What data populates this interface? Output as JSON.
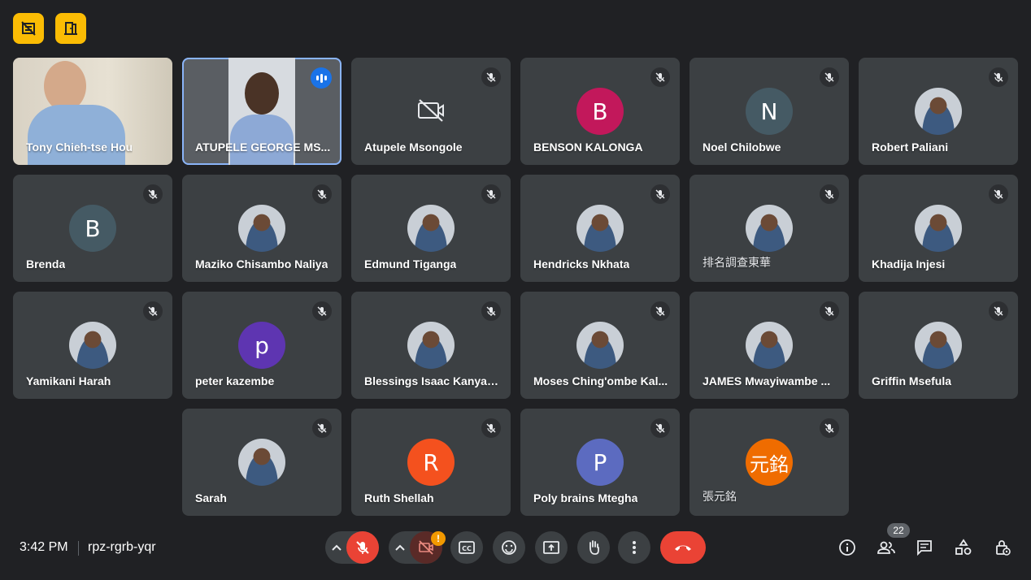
{
  "colors": {
    "background": "#202124",
    "tile": "#3c4043",
    "accent_yellow": "#fbbc04",
    "speaking_blue": "#8ab4f8",
    "end_call_red": "#ea4335"
  },
  "top_icons": [
    "host-controls-icon",
    "exit-door-icon"
  ],
  "participants": [
    {
      "name": "Tony Chieh-tse Hou",
      "type": "video"
    },
    {
      "name": "ATUPELE GEORGE MS...",
      "type": "video",
      "speaking": true
    },
    {
      "name": "Atupele Msongole",
      "type": "camera-off"
    },
    {
      "name": "BENSON KALONGA",
      "initial": "B",
      "color": "#c2185b"
    },
    {
      "name": "Noel Chilobwe",
      "initial": "N",
      "color": "#455a64"
    },
    {
      "name": "Robert Paliani",
      "type": "photo"
    },
    {
      "name": "Brenda",
      "initial": "B",
      "color": "#455a64"
    },
    {
      "name": "Maziko Chisambo Naliya",
      "type": "photo"
    },
    {
      "name": "Edmund Tiganga",
      "type": "photo"
    },
    {
      "name": "Hendricks Nkhata",
      "type": "photo"
    },
    {
      "name": "排名調查東華",
      "type": "photo"
    },
    {
      "name": "Khadija Injesi",
      "type": "photo"
    },
    {
      "name": "Yamikani Harah",
      "type": "photo"
    },
    {
      "name": "peter kazembe",
      "initial": "p",
      "color": "#5e35b1"
    },
    {
      "name": "Blessings Isaac Kanyan...",
      "type": "photo"
    },
    {
      "name": "Moses Ching'ombe Kal...",
      "type": "photo"
    },
    {
      "name": "JAMES Mwayiwambe ...",
      "type": "photo"
    },
    {
      "name": "Griffin Msefula",
      "type": "photo"
    },
    {
      "name": "Sarah",
      "type": "photo"
    },
    {
      "name": "Ruth Shellah",
      "initial": "R",
      "color": "#f4511e"
    },
    {
      "name": "Poly brains Mtegha",
      "initial": "P",
      "color": "#5c6bc0"
    },
    {
      "name": "張元銘",
      "initial": "元銘",
      "color": "#ef6c00"
    }
  ],
  "meeting": {
    "time": "3:42 PM",
    "code": "rpz-rgrb-yqr"
  },
  "controls": {
    "camera_alert": "!",
    "participant_count": "22"
  },
  "control_icons": [
    "chevron-up-icon",
    "mic-off-icon",
    "chevron-up-icon",
    "camera-off-icon",
    "captions-icon",
    "emoji-icon",
    "present-icon",
    "raise-hand-icon",
    "more-options-icon",
    "end-call-icon"
  ],
  "right_icons": [
    "info-icon",
    "people-icon",
    "chat-icon",
    "activities-icon",
    "host-lock-icon"
  ]
}
